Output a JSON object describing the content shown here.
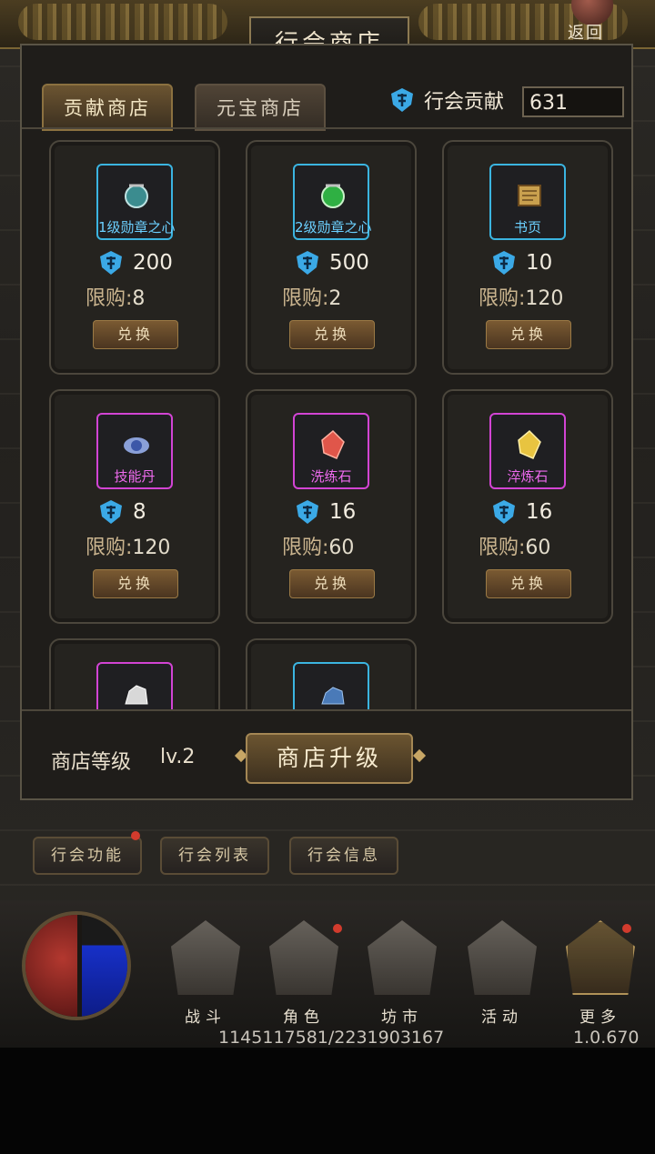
{
  "header": {
    "title": "行会商店",
    "back_label": "返回"
  },
  "tabs": [
    {
      "label": "贡献商店",
      "active": true
    },
    {
      "label": "元宝商店",
      "active": false
    }
  ],
  "contribution": {
    "label": "行会贡献",
    "value": "631",
    "icon": "guild-coin-icon"
  },
  "shop_items": [
    {
      "name": "1级勋章之心",
      "price": "200",
      "limit_label": "限购:",
      "limit": "8",
      "rarity": "blue",
      "gem_color": "#3b8c8f",
      "button": "兑换"
    },
    {
      "name": "2级勋章之心",
      "price": "500",
      "limit_label": "限购:",
      "limit": "2",
      "rarity": "blue",
      "gem_color": "#2fb043",
      "button": "兑换"
    },
    {
      "name": "书页",
      "price": "10",
      "limit_label": "限购:",
      "limit": "120",
      "rarity": "blue",
      "gem_color": "#c9a04e",
      "button": "兑换"
    },
    {
      "name": "技能丹",
      "price": "8",
      "limit_label": "限购:",
      "limit": "120",
      "rarity": "purple",
      "gem_color": "#5a79c4",
      "button": "兑换"
    },
    {
      "name": "洗练石",
      "price": "16",
      "limit_label": "限购:",
      "limit": "60",
      "rarity": "purple",
      "gem_color": "#e0564a",
      "button": "兑换"
    },
    {
      "name": "淬炼石",
      "price": "16",
      "limit_label": "限购:",
      "limit": "60",
      "rarity": "purple",
      "gem_color": "#e8c440",
      "button": "兑换"
    },
    {
      "name": "",
      "rarity": "purple",
      "gem_color": "#d8d8d8"
    },
    {
      "name": "",
      "rarity": "blue",
      "gem_color": "#4a7ab8"
    }
  ],
  "footer": {
    "level_label": "商店等级",
    "level_value": "lv.2",
    "upgrade_label": "商店升级"
  },
  "guild_buttons": [
    "行会功能",
    "行会列表",
    "行会信息"
  ],
  "nav": [
    {
      "label": "战斗",
      "icon": "swords-icon"
    },
    {
      "label": "角色",
      "icon": "helmet-icon"
    },
    {
      "label": "坊市",
      "icon": "market-icon"
    },
    {
      "label": "活动",
      "icon": "gift-icon"
    },
    {
      "label": "更多",
      "icon": "more-icon"
    }
  ],
  "status": {
    "exp": "1145117581/2231903167",
    "version": "1.0.670"
  },
  "colors": {
    "blue_rarity": "#3bb4e0",
    "purple_rarity": "#d244d4",
    "coin": "#3ba9e6",
    "badge_red": "#d23b2d"
  }
}
